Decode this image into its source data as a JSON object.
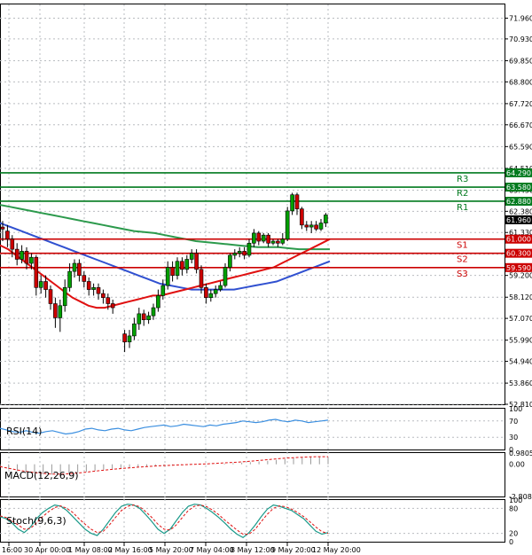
{
  "chart_data": {
    "type": "candlestick",
    "colors": {
      "up": "#00a000",
      "down": "#cc0000",
      "sma_fast": "#e01010",
      "sma_mid": "#2c9a4c",
      "sma_slow": "#3050d0",
      "resistance": "#007a1e",
      "support": "#cc0000",
      "grid": "#b9bcc0",
      "indicator": "#3b8fe0",
      "current_price_bg": "#000000"
    },
    "price_axis": {
      "ylim": [
        52.81,
        72.64
      ],
      "ticks": [
        "71.960",
        "70.930",
        "69.850",
        "68.800",
        "67.720",
        "66.670",
        "65.590",
        "64.510",
        "63.430",
        "62.380",
        "61.330",
        "60.250",
        "59.200",
        "58.120",
        "57.070",
        "55.990",
        "54.940",
        "53.860",
        "52.810"
      ],
      "current_price": "61.960",
      "current_price_value": 61.96
    },
    "time_axis": {
      "labels": [
        "16:00",
        "30 Apr 00:00",
        "1 May 08:00",
        "2 May 16:00",
        "5 May 20:00",
        "7 May 04:00",
        "8 May 12:00",
        "9 May 20:00",
        "12 May 20:00"
      ]
    },
    "levels": [
      {
        "name": "R3",
        "value": 64.29,
        "label": "64.290",
        "kind": "resistance"
      },
      {
        "name": "R2",
        "value": 63.58,
        "label": "63.580",
        "kind": "resistance"
      },
      {
        "name": "R1",
        "value": 62.88,
        "label": "62.880",
        "kind": "resistance"
      },
      {
        "name": "S1",
        "value": 61.0,
        "label": "61.000",
        "kind": "support"
      },
      {
        "name": "S2",
        "value": 60.3,
        "label": "60.300",
        "kind": "support"
      },
      {
        "name": "S3",
        "value": 59.59,
        "label": "59.590",
        "kind": "support"
      }
    ],
    "candles": [
      [
        61.6,
        61.5,
        61.9,
        60.9
      ],
      [
        61.4,
        61.0,
        61.7,
        60.6
      ],
      [
        61.0,
        60.5,
        61.2,
        60.1
      ],
      [
        60.5,
        60.0,
        60.8,
        59.7
      ],
      [
        60.0,
        60.4,
        60.7,
        59.8
      ],
      [
        60.4,
        59.8,
        60.6,
        59.5
      ],
      [
        59.8,
        60.1,
        60.3,
        59.5
      ],
      [
        60.1,
        58.6,
        60.2,
        58.2
      ],
      [
        58.6,
        58.9,
        59.2,
        58.3
      ],
      [
        58.9,
        58.5,
        59.2,
        58.1
      ],
      [
        58.5,
        57.8,
        58.7,
        57.5
      ],
      [
        57.8,
        57.1,
        58.1,
        56.6
      ],
      [
        57.1,
        57.7,
        58.0,
        56.4
      ],
      [
        57.7,
        58.6,
        59.0,
        57.4
      ],
      [
        58.6,
        59.4,
        59.8,
        58.4
      ],
      [
        59.4,
        59.8,
        60.0,
        59.1
      ],
      [
        59.8,
        59.2,
        60.0,
        58.9
      ],
      [
        59.2,
        58.9,
        59.4,
        58.6
      ],
      [
        58.9,
        58.5,
        59.1,
        58.2
      ],
      [
        58.5,
        58.6,
        58.8,
        58.2
      ],
      [
        58.6,
        58.3,
        58.8,
        58.0
      ],
      [
        58.3,
        58.1,
        58.5,
        57.8
      ],
      [
        58.1,
        57.8,
        58.3,
        57.5
      ],
      [
        57.8,
        57.6,
        58.0,
        57.3
      ],
      [
        56.3,
        55.9,
        56.5,
        55.4
      ],
      [
        55.9,
        56.2,
        56.5,
        55.6
      ],
      [
        56.2,
        56.8,
        57.1,
        56.0
      ],
      [
        56.8,
        57.3,
        57.6,
        56.5
      ],
      [
        57.3,
        57.0,
        57.5,
        56.7
      ],
      [
        57.0,
        57.2,
        57.4,
        56.8
      ],
      [
        57.2,
        57.6,
        57.8,
        57.0
      ],
      [
        57.6,
        58.2,
        58.5,
        57.4
      ],
      [
        58.2,
        58.7,
        59.0,
        58.0
      ],
      [
        58.7,
        59.6,
        59.9,
        58.5
      ],
      [
        59.6,
        59.2,
        59.9,
        58.9
      ],
      [
        59.2,
        59.9,
        60.1,
        59.0
      ],
      [
        59.9,
        59.5,
        60.1,
        59.2
      ],
      [
        59.5,
        60.0,
        60.2,
        59.3
      ],
      [
        60.0,
        60.3,
        60.5,
        59.8
      ],
      [
        60.3,
        59.5,
        60.5,
        59.3
      ],
      [
        59.5,
        58.6,
        59.7,
        58.3
      ],
      [
        58.6,
        58.1,
        58.8,
        57.8
      ],
      [
        58.1,
        58.3,
        58.5,
        57.9
      ],
      [
        58.3,
        58.5,
        58.7,
        58.1
      ],
      [
        58.5,
        58.7,
        58.9,
        58.4
      ],
      [
        58.7,
        59.6,
        59.8,
        58.6
      ],
      [
        59.6,
        60.2,
        60.3,
        59.4
      ],
      [
        60.2,
        60.3,
        60.5,
        60.0
      ],
      [
        60.3,
        60.4,
        60.6,
        60.1
      ],
      [
        60.4,
        60.2,
        60.6,
        60.0
      ],
      [
        60.2,
        60.8,
        61.0,
        60.1
      ],
      [
        60.8,
        61.3,
        61.5,
        60.6
      ],
      [
        61.3,
        60.9,
        61.4,
        60.7
      ],
      [
        60.9,
        61.2,
        61.3,
        60.8
      ],
      [
        61.2,
        60.8,
        61.3,
        60.6
      ],
      [
        60.8,
        60.9,
        61.0,
        60.7
      ],
      [
        60.9,
        60.8,
        61.0,
        60.6
      ],
      [
        60.8,
        61.0,
        61.3,
        60.7
      ],
      [
        61.0,
        62.4,
        62.6,
        60.9
      ],
      [
        62.4,
        63.2,
        63.3,
        62.2
      ],
      [
        63.2,
        62.5,
        63.3,
        62.2
      ],
      [
        62.5,
        61.7,
        62.6,
        61.5
      ],
      [
        61.7,
        61.6,
        61.9,
        61.4
      ],
      [
        61.6,
        61.7,
        61.9,
        61.3
      ],
      [
        61.7,
        61.5,
        61.9,
        61.4
      ],
      [
        61.5,
        61.8,
        62.0,
        61.4
      ],
      [
        61.8,
        62.2,
        62.3,
        61.6
      ]
    ],
    "sma_fast": [
      60.7,
      60.5,
      60.2,
      59.9,
      59.6,
      59.3,
      59.0,
      58.7,
      58.4,
      58.1,
      57.9,
      57.7,
      57.6,
      57.6,
      57.7,
      57.8,
      57.9,
      58.0,
      58.1,
      58.2,
      58.2,
      58.3,
      58.4,
      58.5,
      58.6,
      58.7,
      58.8,
      58.9,
      59.0,
      59.1,
      59.2,
      59.3,
      59.4,
      59.5,
      59.6,
      59.8,
      60.0,
      60.2,
      60.4,
      60.6,
      60.8,
      61.0
    ],
    "sma_mid": [
      62.7,
      62.6,
      62.5,
      62.4,
      62.3,
      62.2,
      62.1,
      62.0,
      61.9,
      61.8,
      61.7,
      61.6,
      61.5,
      61.4,
      61.35,
      61.3,
      61.2,
      61.1,
      61.0,
      60.9,
      60.85,
      60.8,
      60.75,
      60.7,
      60.65,
      60.6,
      60.6,
      60.6,
      60.55,
      60.5,
      60.5,
      60.5,
      60.5
    ],
    "sma_slow": [
      61.8,
      61.6,
      61.4,
      61.2,
      61.0,
      60.8,
      60.6,
      60.4,
      60.2,
      60.0,
      59.8,
      59.6,
      59.4,
      59.2,
      59.0,
      58.8,
      58.7,
      58.6,
      58.5,
      58.5,
      58.5,
      58.5,
      58.5,
      58.6,
      58.7,
      58.8,
      58.9,
      59.1,
      59.3,
      59.5,
      59.7,
      59.9
    ],
    "rsi": {
      "label": "RSI(14)",
      "ylim": [
        0,
        100
      ],
      "ticks": [
        "100",
        "70",
        "30",
        "0"
      ],
      "values": [
        52,
        48,
        44,
        42,
        46,
        42,
        40,
        44,
        46,
        42,
        38,
        40,
        44,
        50,
        52,
        48,
        46,
        50,
        52,
        48,
        46,
        50,
        54,
        56,
        58,
        60,
        56,
        58,
        62,
        60,
        58,
        56,
        60,
        58,
        62,
        64,
        66,
        70,
        68,
        66,
        68,
        72,
        74,
        70,
        68,
        72,
        70,
        66,
        68,
        70,
        72
      ]
    },
    "macd": {
      "label": "MACD(12,26,9)",
      "ylim": [
        -2.8089,
        0.9805
      ],
      "ticks": [
        "0.9805",
        "0.00",
        "-2.8089"
      ],
      "histogram": [
        -0.25,
        -0.45,
        -0.6,
        -0.72,
        -0.8,
        -0.86,
        -0.9,
        -0.88,
        -0.82,
        -0.74,
        -0.65,
        -0.56,
        -0.48,
        -0.4,
        -0.34,
        -0.28,
        -0.22,
        -0.17,
        -0.13,
        -0.1,
        -0.08,
        -0.06,
        -0.04,
        -0.03,
        -0.02,
        0.02,
        0.06,
        0.1,
        0.14,
        0.18,
        0.24,
        0.3,
        0.38,
        0.46,
        0.54,
        0.6,
        0.64,
        0.66,
        0.66
      ],
      "signal": [
        -0.2,
        -0.35,
        -0.5,
        -0.62,
        -0.72,
        -0.8,
        -0.85,
        -0.86,
        -0.83,
        -0.77,
        -0.69,
        -0.6,
        -0.52,
        -0.44,
        -0.37,
        -0.31,
        -0.25,
        -0.2,
        -0.15,
        -0.11,
        -0.08,
        -0.05,
        -0.02,
        0.01,
        0.04,
        0.08,
        0.12,
        0.16,
        0.21,
        0.27,
        0.33,
        0.4,
        0.47,
        0.53,
        0.58,
        0.62,
        0.65,
        0.66,
        0.66
      ]
    },
    "stoch": {
      "label": "Stoch(9,6,3)",
      "ylim": [
        0,
        100
      ],
      "ticks": [
        "100",
        "80",
        "20",
        "0"
      ],
      "main": [
        60,
        55,
        45,
        30,
        22,
        35,
        55,
        70,
        80,
        88,
        85,
        75,
        60,
        45,
        30,
        20,
        15,
        30,
        50,
        70,
        85,
        90,
        88,
        80,
        65,
        48,
        30,
        20,
        30,
        50,
        70,
        85,
        90,
        88,
        80,
        70,
        58,
        45,
        30,
        18,
        10,
        22,
        40,
        60,
        78,
        88,
        85,
        80,
        75,
        65,
        55,
        40,
        25,
        18,
        22
      ],
      "signal": [
        62,
        58,
        50,
        40,
        30,
        32,
        45,
        60,
        72,
        82,
        86,
        80,
        70,
        55,
        42,
        30,
        22,
        25,
        40,
        58,
        75,
        85,
        88,
        84,
        72,
        58,
        42,
        30,
        28,
        40,
        58,
        75,
        85,
        88,
        84,
        76,
        65,
        52,
        40,
        28,
        18,
        18,
        30,
        48,
        66,
        80,
        86,
        84,
        78,
        70,
        60,
        48,
        35,
        24,
        20
      ]
    }
  }
}
